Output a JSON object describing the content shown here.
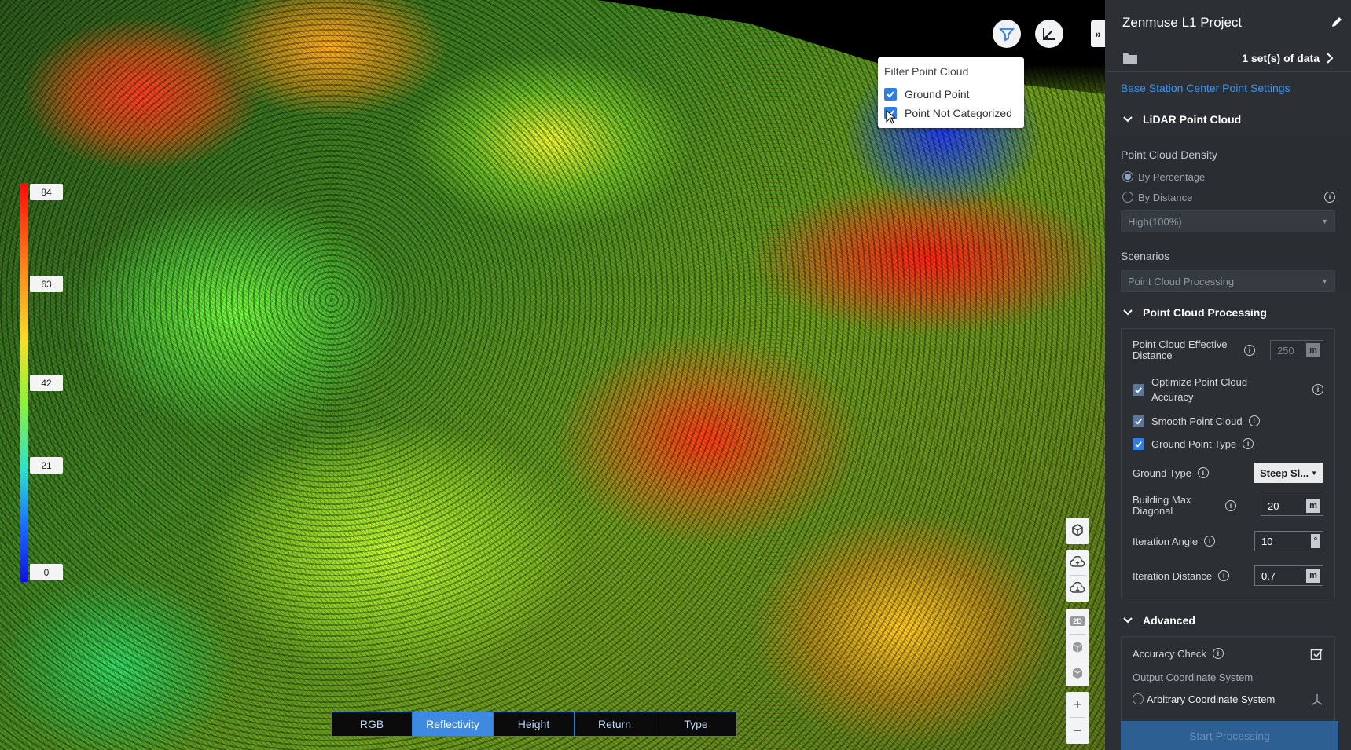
{
  "legend": {
    "ticks": [
      "84",
      "63",
      "42",
      "21",
      "0"
    ]
  },
  "filter_popup": {
    "title": "Filter Point Cloud",
    "items": [
      {
        "label": "Ground Point",
        "checked": true
      },
      {
        "label": "Point Not Categorized",
        "checked": true
      }
    ]
  },
  "view_tabs": [
    "RGB",
    "Reflectivity",
    "Height",
    "Return",
    "Type"
  ],
  "active_tab": "Reflectivity",
  "right_toolbar": {
    "view_2d_label": "2D"
  },
  "panel": {
    "title": "Zenmuse L1 Project",
    "data_sets": "1 set(s) of data",
    "base_station_link": "Base Station Center Point Settings",
    "lidar_section": "LiDAR Point Cloud",
    "density_label": "Point Cloud Density",
    "density_options": [
      "By Percentage",
      "By Distance"
    ],
    "density_selected": "By Percentage",
    "density_value": "High(100%)",
    "scenarios_label": "Scenarios",
    "scenarios_value": "Point Cloud Processing",
    "processing_section": "Point Cloud Processing",
    "effective_distance_label": "Point Cloud Effective Distance",
    "effective_distance_value": "250",
    "effective_distance_unit": "m",
    "optimize_label": "Optimize Point Cloud Accuracy",
    "smooth_label": "Smooth Point Cloud",
    "ground_point_type_label": "Ground Point Type",
    "ground_type_label": "Ground Type",
    "ground_type_value": "Steep Sl...",
    "building_max_label": "Building Max Diagonal",
    "building_max_value": "20",
    "building_max_unit": "m",
    "iteration_angle_label": "Iteration Angle",
    "iteration_angle_value": "10",
    "iteration_angle_unit": "°",
    "iteration_distance_label": "Iteration Distance",
    "iteration_distance_value": "0.7",
    "iteration_distance_unit": "m",
    "advanced_section": "Advanced",
    "accuracy_check_label": "Accuracy Check",
    "output_coord_label": "Output Coordinate System",
    "arbitrary_coord_label": "Arbitrary Coordinate System",
    "start_button": "Start Processing"
  },
  "colors": {
    "accent": "#3d8ae0",
    "panel_bg": "#2c3035",
    "link": "#3f93ec"
  }
}
